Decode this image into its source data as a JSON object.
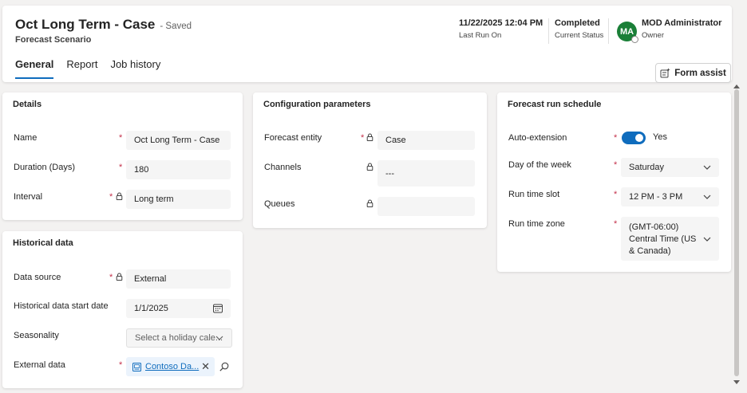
{
  "header": {
    "title": "Oct Long Term - Case",
    "saved": "- Saved",
    "subtitle": "Forecast Scenario",
    "last_run_value": "11/22/2025 12:04 PM",
    "last_run_label": "Last Run On",
    "status_value": "Completed",
    "status_label": "Current Status",
    "avatar_initials": "MA",
    "owner_value": "MOD Administrator",
    "owner_label": "Owner",
    "form_assist": "Form assist"
  },
  "tabs": [
    "General",
    "Report",
    "Job history"
  ],
  "details": {
    "title": "Details",
    "name_label": "Name",
    "name_value": "Oct Long Term - Case",
    "duration_label": "Duration (Days)",
    "duration_value": "180",
    "interval_label": "Interval",
    "interval_value": "Long term"
  },
  "historical": {
    "title": "Historical data",
    "source_label": "Data source",
    "source_value": "External",
    "start_label": "Historical data start date",
    "start_value": "1/1/2025",
    "seasonality_label": "Seasonality",
    "seasonality_placeholder": "Select a holiday cale...",
    "external_label": "External data",
    "external_value": "Contoso Da..."
  },
  "config": {
    "title": "Configuration parameters",
    "entity_label": "Forecast entity",
    "entity_value": "Case",
    "channels_label": "Channels",
    "channels_value": "---",
    "queues_label": "Queues",
    "queues_value": ""
  },
  "schedule": {
    "title": "Forecast run schedule",
    "auto_label": "Auto-extension",
    "auto_value": "Yes",
    "day_label": "Day of the week",
    "day_value": "Saturday",
    "slot_label": "Run time slot",
    "slot_value": "12 PM - 3 PM",
    "zone_label": "Run time zone",
    "zone_value": "(GMT-06:00) Central Time (US & Canada)"
  },
  "colors": {
    "accent": "#0f6cbd",
    "required": "#c4314b",
    "avatar": "#1a7f37"
  },
  "icons": [
    "form-assist-icon",
    "lock-icon",
    "calendar-icon",
    "chevron-down-icon",
    "lookup-record-icon",
    "clear-icon",
    "search-icon"
  ]
}
